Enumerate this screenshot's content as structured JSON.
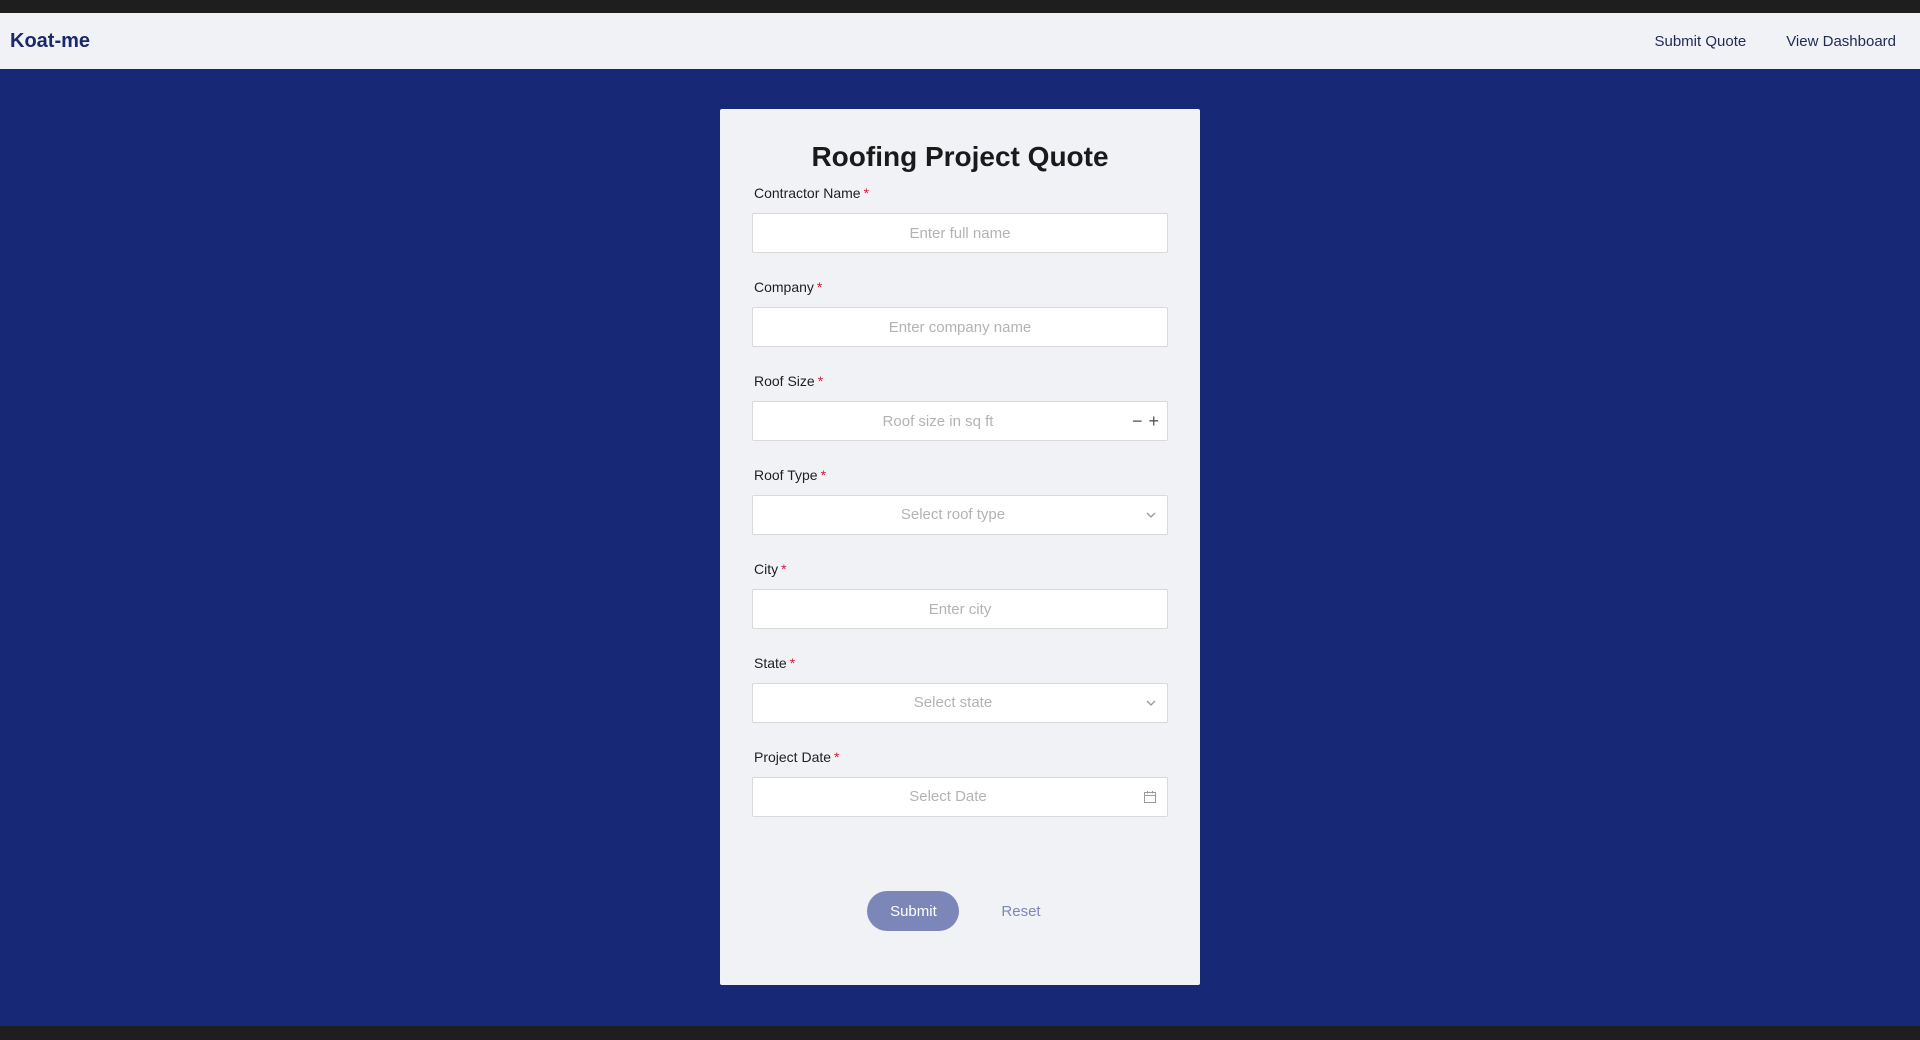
{
  "nav": {
    "brand": "Koat-me",
    "links": [
      {
        "label": "Submit Quote"
      },
      {
        "label": "View Dashboard"
      }
    ]
  },
  "form": {
    "title": "Roofing Project Quote",
    "required_mark": "*",
    "fields": {
      "contractor_name": {
        "label": "Contractor Name",
        "placeholder": "Enter full name"
      },
      "company": {
        "label": "Company",
        "placeholder": "Enter company name"
      },
      "roof_size": {
        "label": "Roof Size",
        "placeholder": "Roof size in sq ft",
        "decrement": "−",
        "increment": "+"
      },
      "roof_type": {
        "label": "Roof Type",
        "placeholder": "Select roof type"
      },
      "city": {
        "label": "City",
        "placeholder": "Enter city"
      },
      "state": {
        "label": "State",
        "placeholder": "Select state"
      },
      "project_date": {
        "label": "Project Date",
        "placeholder": "Select Date"
      }
    },
    "actions": {
      "submit": "Submit",
      "reset": "Reset"
    }
  },
  "icons": {
    "chevron": "chevron-down-icon",
    "calendar": "calendar-icon"
  },
  "colors": {
    "background": "#172876",
    "brand": "#1b2a6b",
    "required": "#d4183d",
    "button": "#7c86b8"
  }
}
